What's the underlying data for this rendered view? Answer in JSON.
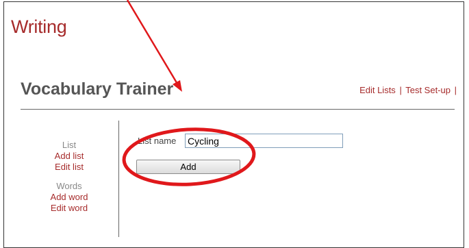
{
  "section_title": "Writing",
  "app_title": "Vocabulary Trainer",
  "top_nav": {
    "edit_lists": "Edit Lists",
    "separator": "|",
    "test_setup": "Test Set-up",
    "trailing_separator": "|"
  },
  "sidebar": {
    "list_heading": "List",
    "add_list": "Add list",
    "edit_list": "Edit list",
    "words_heading": "Words",
    "add_word": "Add word",
    "edit_word": "Edit word"
  },
  "form": {
    "list_name_label": "List name",
    "list_name_value": "Cycling",
    "add_button_label": "Add"
  },
  "annotation": {
    "color": "#e0181b",
    "shapes": [
      "arrow-annotation",
      "highlight-ellipse"
    ]
  }
}
